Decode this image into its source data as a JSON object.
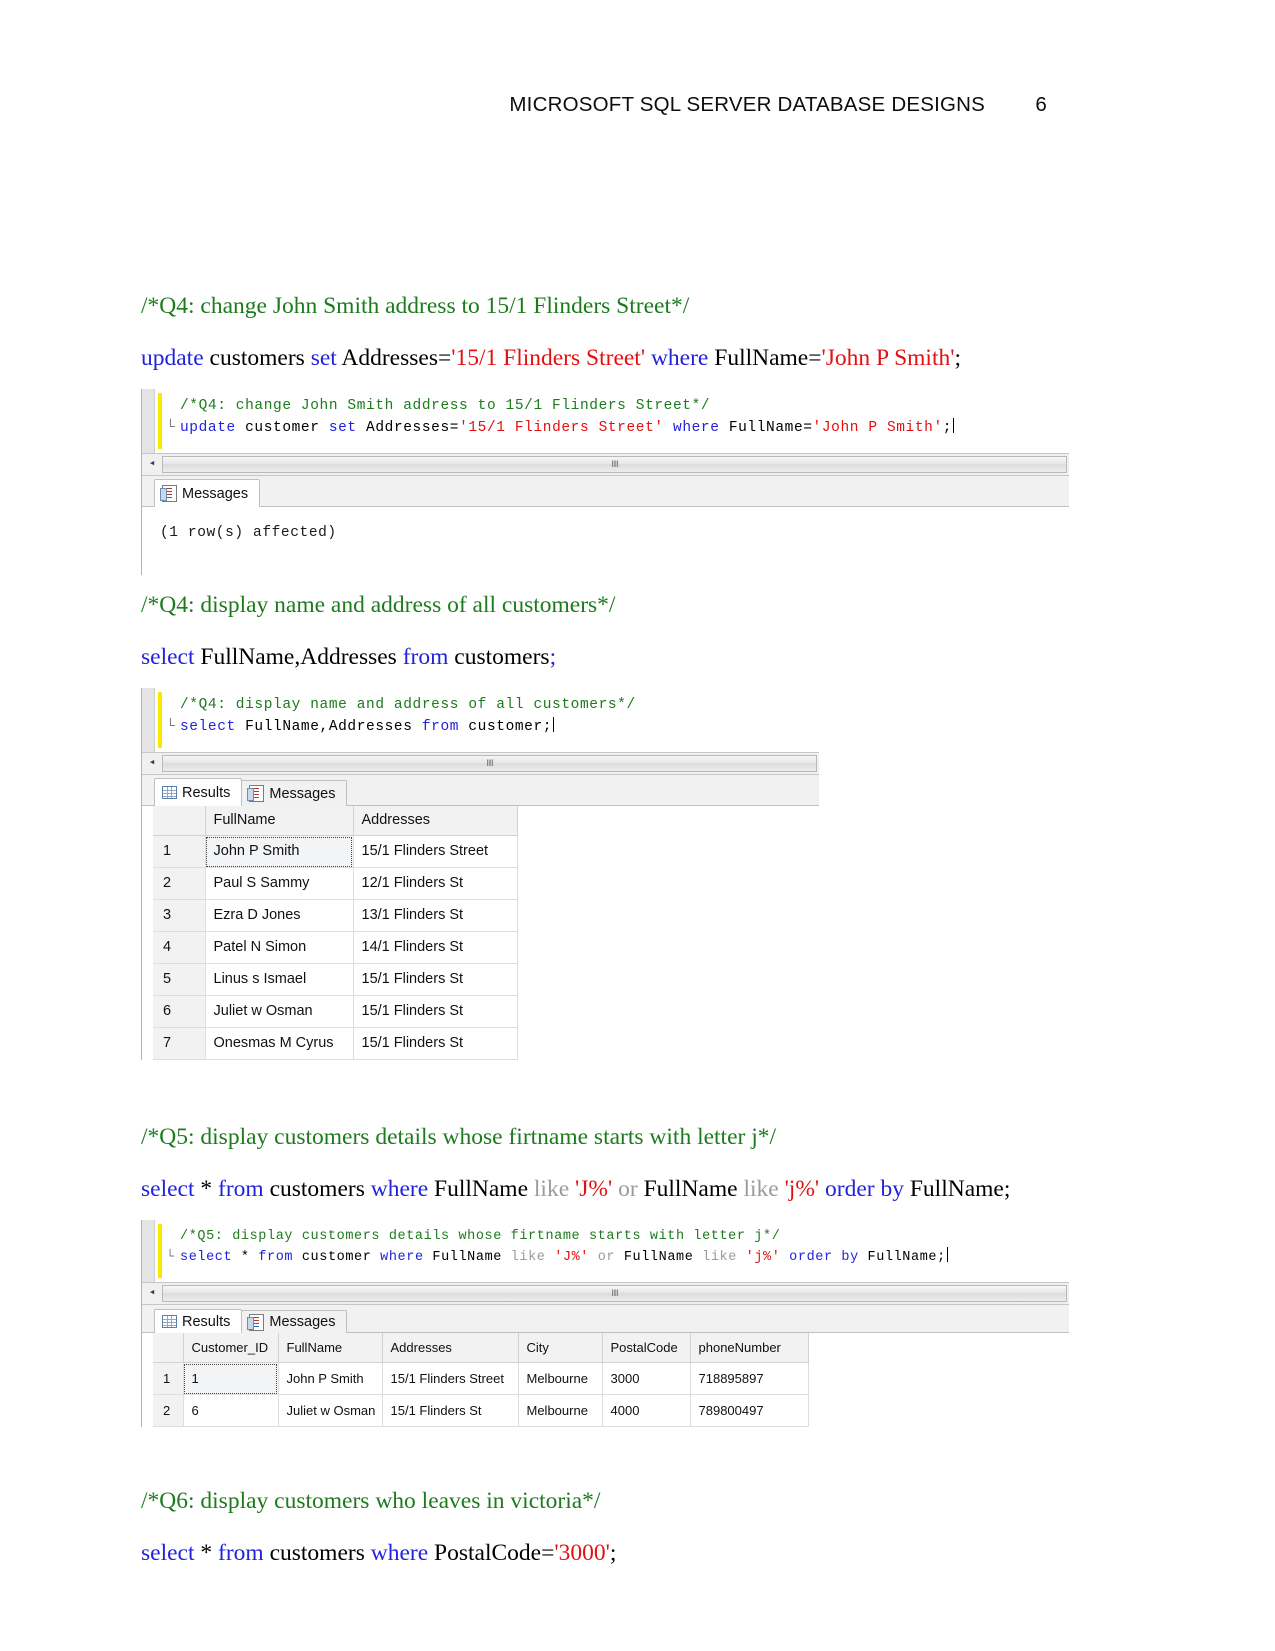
{
  "header": {
    "title": "MICROSOFT SQL SERVER DATABASE DESIGNS",
    "page_number": "6"
  },
  "sections": [
    {
      "id": "q4-update",
      "doc_comment": "/*Q4: change John Smith address to 15/1 Flinders Street*/",
      "statement": {
        "t1": "update",
        "t2": " customers ",
        "t3": "set",
        "t4": " Addresses=",
        "t5": "'15/1 Flinders Street'",
        "t6": " ",
        "t7": "where",
        "t8": " FullName=",
        "t9": "'John P Smith'",
        "t10": ";"
      },
      "editor": {
        "comment_line": "/*Q4: change John Smith address to 15/1 Flinders Street*/",
        "code": {
          "k1": "update",
          "p1": " customer ",
          "k2": "set",
          "p2": " Addresses=",
          "s1": "'15/1 Flinders Street'",
          "p3": " ",
          "k3": "where",
          "p4": " FullName=",
          "s2": "'John P Smith'",
          "p5": ";"
        }
      },
      "tabs": [
        {
          "label": "Messages",
          "icon": "messages-icon",
          "active": true
        }
      ],
      "messages_text": "(1 row(s) affected)"
    },
    {
      "id": "q4-select",
      "doc_comment": "/*Q4: display name and address of all customers*/",
      "statement": {
        "t1": "select",
        "t2": " FullName,Addresses ",
        "t3": "from",
        "t4": " customers",
        "t5": ";"
      },
      "editor": {
        "comment_line": "/*Q4: display name and address of all customers*/",
        "code": {
          "k1": "select",
          "p1": " FullName,Addresses ",
          "k2": "from",
          "p2": " customer;"
        }
      },
      "tabs": [
        {
          "label": "Results",
          "icon": "results-grid-icon",
          "active": true
        },
        {
          "label": "Messages",
          "icon": "messages-icon",
          "active": false
        }
      ],
      "grid": {
        "columns": [
          "",
          "FullName",
          "Addresses"
        ],
        "rows": [
          [
            "1",
            "John P Smith",
            "15/1 Flinders Street"
          ],
          [
            "2",
            "Paul S Sammy",
            "12/1 Flinders St"
          ],
          [
            "3",
            "Ezra D Jones",
            "13/1 Flinders St"
          ],
          [
            "4",
            "Patel N Simon",
            "14/1 Flinders St"
          ],
          [
            "5",
            "Linus s Ismael",
            "15/1 Flinders St"
          ],
          [
            "6",
            "Juliet w Osman",
            "15/1 Flinders St"
          ],
          [
            "7",
            "Onesmas M Cyrus",
            "15/1 Flinders St"
          ]
        ]
      }
    },
    {
      "id": "q5",
      "doc_comment": "/*Q5: display customers details whose firtname starts with letter j*/",
      "statement": {
        "t1": "select",
        "t2": " * ",
        "t3": "from",
        "t4": " customers ",
        "t5": "where",
        "t6": " FullName ",
        "t7": "like",
        "t8": " ",
        "t9": "'J%'",
        "t10": " or",
        "t11": " FullName ",
        "t12": "like",
        "t13": " ",
        "t14": "'j%'",
        "t15": " ",
        "t16": "order by",
        "t17": " FullName;"
      },
      "editor": {
        "comment_line": "/*Q5: display customers details whose firtname starts with letter j*/",
        "code": {
          "k1": "select",
          "p1": " * ",
          "k2": "from",
          "p2": " customer ",
          "k3": "where",
          "p3": " FullName ",
          "g1": "like",
          "p4": " ",
          "s1": "'J%'",
          "g2": " or",
          "p5": " FullName ",
          "g3": "like",
          "p6": " ",
          "s2": "'j%'",
          "p7": " ",
          "k4": "order by",
          "p8": " FullName;"
        }
      },
      "tabs": [
        {
          "label": "Results",
          "icon": "results-grid-icon",
          "active": true
        },
        {
          "label": "Messages",
          "icon": "messages-icon",
          "active": false
        }
      ],
      "grid": {
        "columns": [
          "",
          "Customer_ID",
          "FullName",
          "Addresses",
          "City",
          "PostalCode",
          "phoneNumber"
        ],
        "rows": [
          [
            "1",
            "1",
            "John P Smith",
            "15/1 Flinders Street",
            "Melbourne",
            "3000",
            "718895897"
          ],
          [
            "2",
            "6",
            "Juliet w Osman",
            "15/1 Flinders St",
            "Melbourne",
            "4000",
            "789800497"
          ]
        ]
      }
    },
    {
      "id": "q6",
      "doc_comment": "/*Q6: display customers who leaves in victoria*/",
      "statement": {
        "t1": "select",
        "t2": " * ",
        "t3": "from",
        "t4": " customers ",
        "t5": "where",
        "t6": " PostalCode=",
        "t7": "'3000'",
        "t8": ";"
      }
    }
  ],
  "colors": {
    "comment_green": "#1d7b1d",
    "keyword_blue": "#2222dd",
    "string_red": "#e21010",
    "grey_keyword": "#9b9b9b",
    "highlight_yellow": "#fbe700"
  }
}
